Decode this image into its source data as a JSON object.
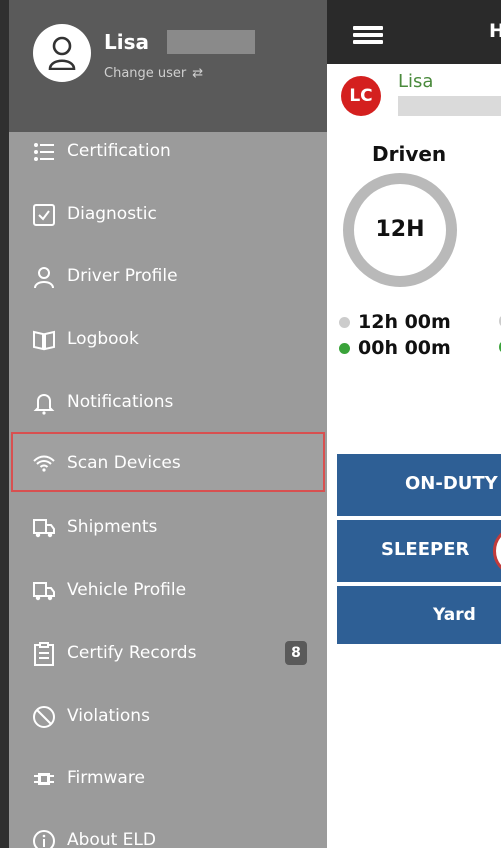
{
  "drawer": {
    "user": {
      "name": "Lisa",
      "change_user_label": "Change user"
    },
    "menu": [
      {
        "label": "Certification",
        "icon": "checklist-icon"
      },
      {
        "label": "Diagnostic",
        "icon": "checkbox-icon"
      },
      {
        "label": "Driver Profile",
        "icon": "person-icon"
      },
      {
        "label": "Logbook",
        "icon": "book-icon"
      },
      {
        "label": "Notifications",
        "icon": "bell-icon"
      },
      {
        "label": "Scan Devices",
        "icon": "wifi-icon",
        "highlighted": true
      },
      {
        "label": "Shipments",
        "icon": "truck-icon"
      },
      {
        "label": "Vehicle Profile",
        "icon": "truck-icon"
      },
      {
        "label": "Certify Records",
        "icon": "clipboard-icon",
        "badge": "8"
      },
      {
        "label": "Violations",
        "icon": "prohibited-icon"
      },
      {
        "label": "Firmware",
        "icon": "chip-icon"
      },
      {
        "label": "About ELD",
        "icon": "info-icon"
      }
    ]
  },
  "main": {
    "topbar": {
      "title": "H"
    },
    "driver": {
      "initials": "LC",
      "name": "Lisa"
    },
    "driven": {
      "label": "Driven",
      "gauge_value": "12H",
      "legend": [
        {
          "value": "12h 00m",
          "color": "#cccccc"
        },
        {
          "value": "00h 00m",
          "color": "#3aa33a"
        }
      ]
    },
    "status_buttons": {
      "on_duty": "ON-DUTY",
      "sleeper": "SLEEPER",
      "yard": "Yard"
    }
  },
  "colors": {
    "drawer_bg": "#9b9b9b",
    "header_bg": "#5a5a5a",
    "button_blue": "#2e5f95",
    "highlight_border": "#d85050",
    "avatar_red": "#d4201f"
  }
}
